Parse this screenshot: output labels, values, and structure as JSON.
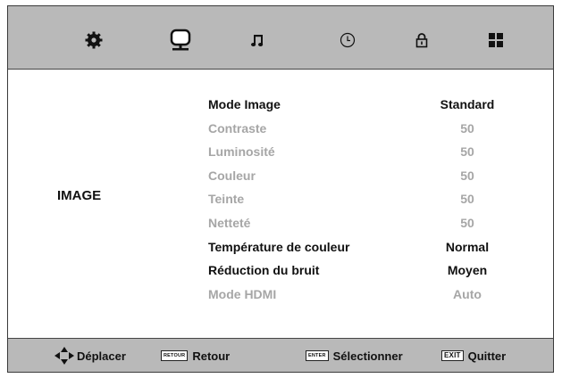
{
  "tabs": [
    {
      "icon": "gear-icon"
    },
    {
      "icon": "monitor-icon"
    },
    {
      "icon": "music-note-icon"
    },
    {
      "icon": "clock-icon"
    },
    {
      "icon": "lock-icon"
    },
    {
      "icon": "grid-icon"
    }
  ],
  "section": {
    "title": "IMAGE"
  },
  "settings": [
    {
      "label": "Mode Image",
      "value": "Standard",
      "enabled": true
    },
    {
      "label": "Contraste",
      "value": "50",
      "enabled": false
    },
    {
      "label": "Luminosité",
      "value": "50",
      "enabled": false
    },
    {
      "label": "Couleur",
      "value": "50",
      "enabled": false
    },
    {
      "label": "Teinte",
      "value": "50",
      "enabled": false
    },
    {
      "label": "Netteté",
      "value": "50",
      "enabled": false
    },
    {
      "label": "Température de couleur",
      "value": "Normal",
      "enabled": true
    },
    {
      "label": "Réduction du bruit",
      "value": "Moyen",
      "enabled": true
    },
    {
      "label": "Mode HDMI",
      "value": "Auto",
      "enabled": false
    }
  ],
  "footer": {
    "move_label": "Déplacer",
    "back_key": "RETOUR",
    "back_label": "Retour",
    "enter_key": "ENTER",
    "enter_label": "Sélectionner",
    "exit_key": "EXIT",
    "exit_label": "Quitter"
  },
  "colors": {
    "bar": "#b9b9b9",
    "active_text": "#111111",
    "inactive_text": "#a6a6a6"
  }
}
